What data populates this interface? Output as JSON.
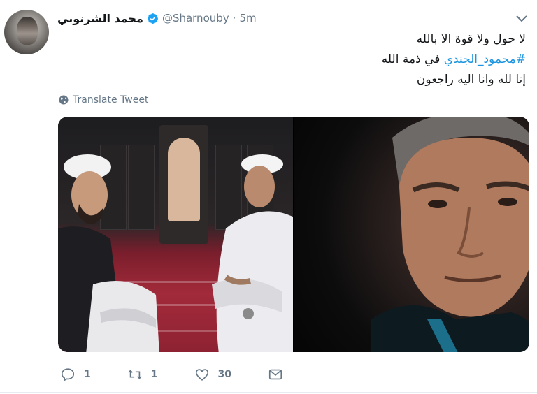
{
  "tweet": {
    "author_name": "محمد الشرنوبي",
    "handle": "@Sharnouby",
    "separator": "·",
    "time": "5m",
    "verified": true,
    "lines": [
      {
        "text": "لا حول ولا قوة الا بالله",
        "hashtag": ""
      },
      {
        "hashtag": "#محمود_الجندي",
        "text": " في ذمة الله"
      },
      {
        "text": "إنا لله وانا اليه راجعون",
        "hashtag": ""
      }
    ],
    "translate_label": "Translate Tweet"
  },
  "actions": {
    "reply_count": "1",
    "retweet_count": "1",
    "like_count": "30"
  },
  "icons": {
    "avatar": "avatar",
    "verified": "verified-badge-icon",
    "caret": "chevron-down-icon",
    "translate": "globe-icon",
    "reply": "reply-icon",
    "retweet": "retweet-icon",
    "like": "heart-icon",
    "dm": "direct-message-icon"
  },
  "colors": {
    "link": "#1b95e0",
    "muted": "#657786",
    "text": "#14171a",
    "verified": "#1da1f2"
  }
}
